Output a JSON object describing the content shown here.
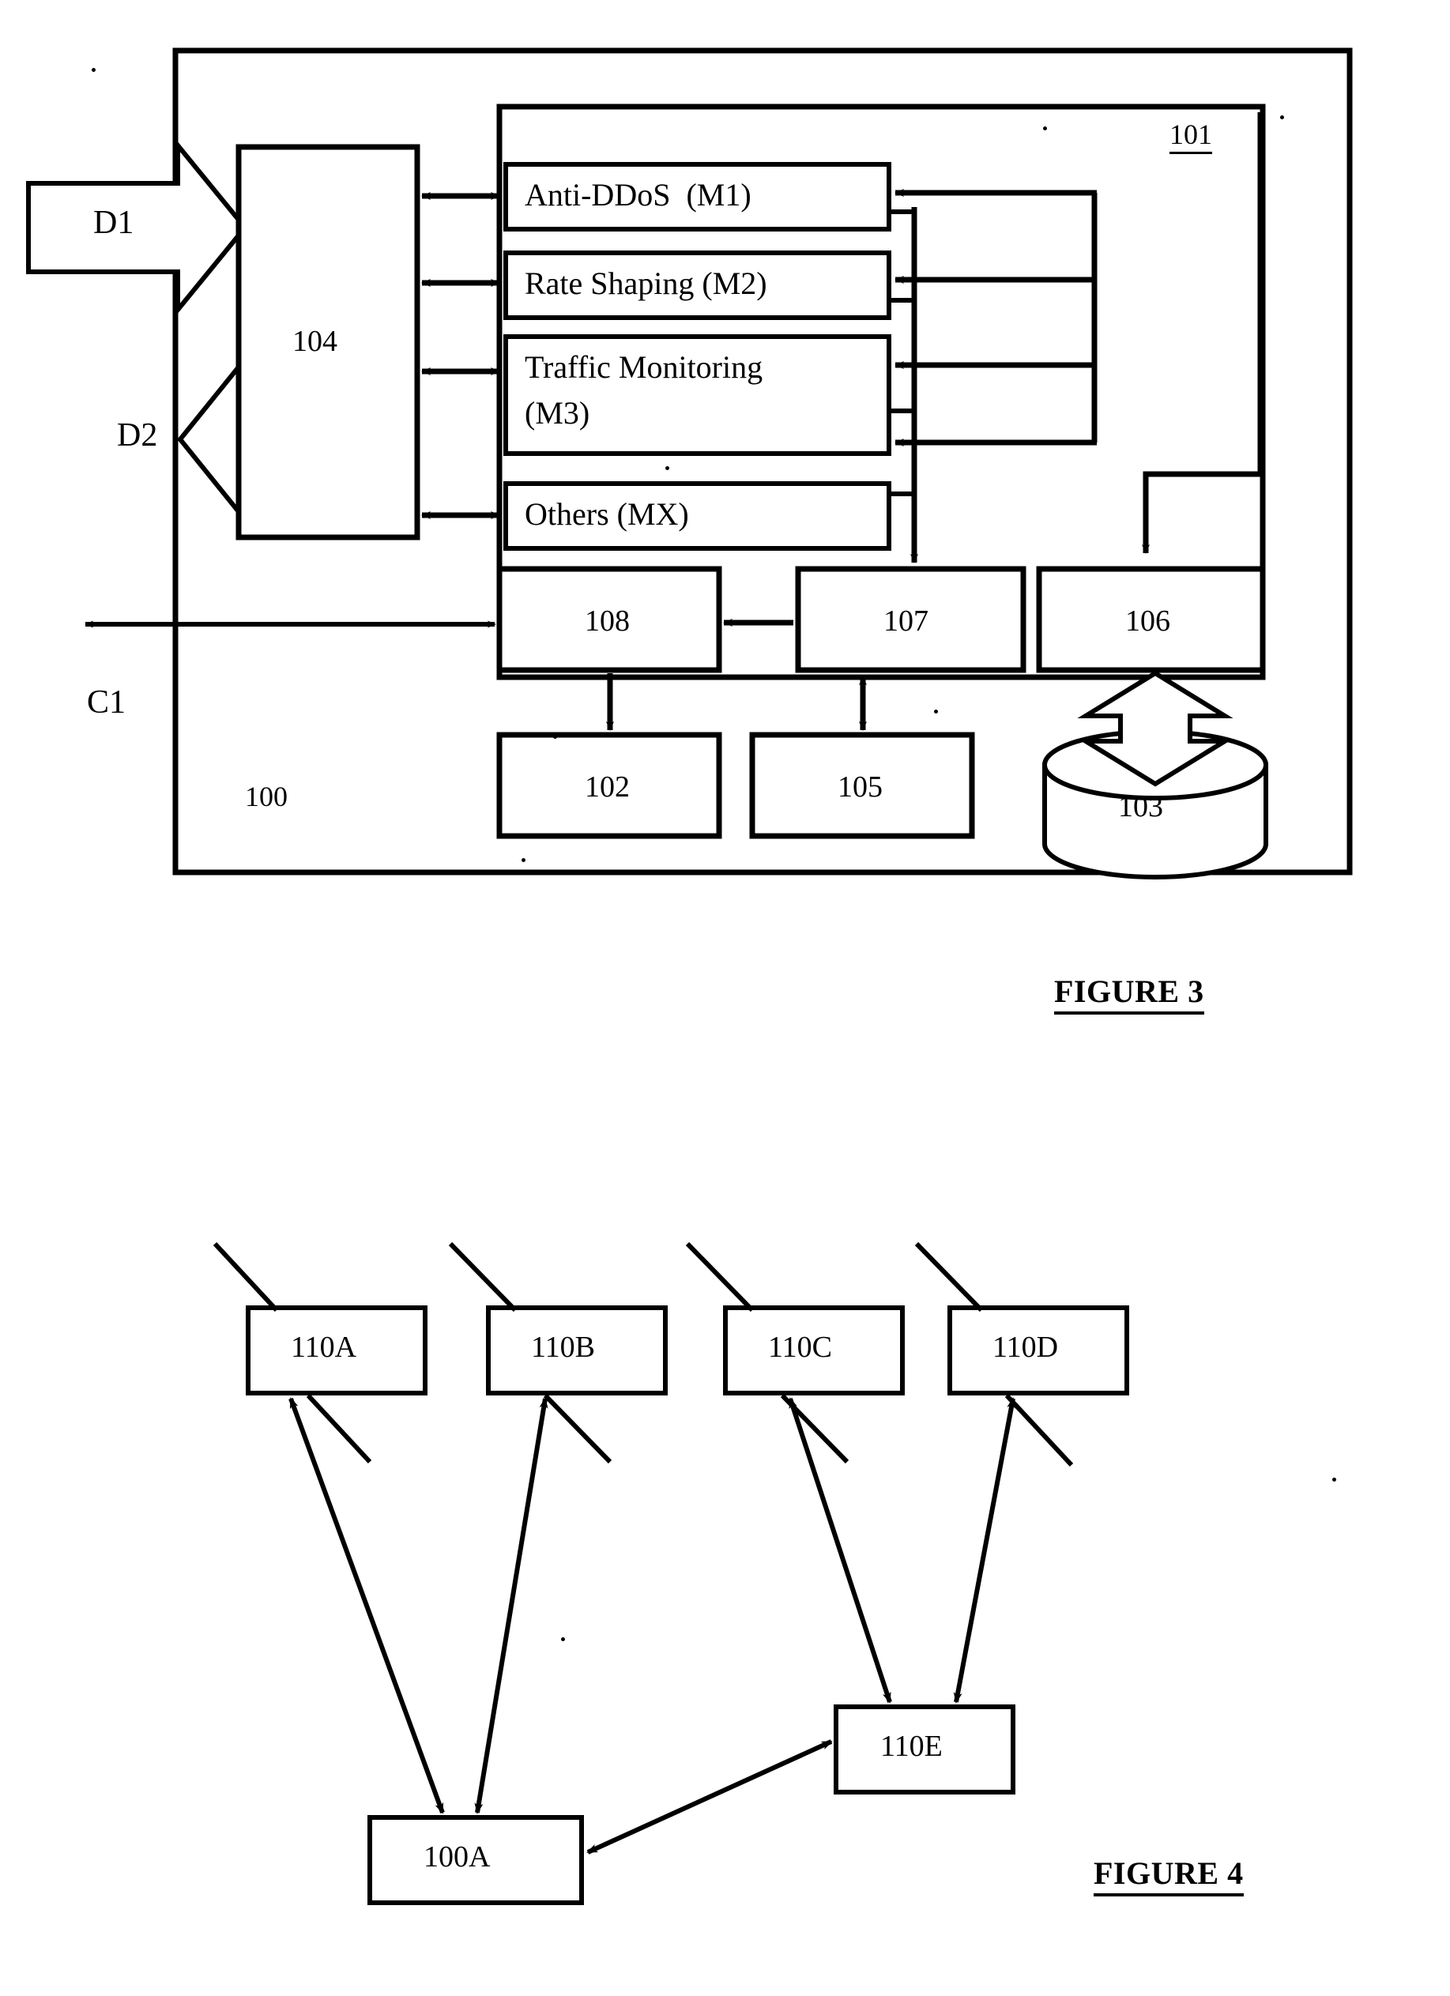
{
  "document": {
    "type": "patent-drawing-sheet",
    "figures": [
      "FIGURE 3",
      "FIGURE 4"
    ]
  },
  "figure3": {
    "caption": "FIGURE 3",
    "outer_system_ref": "100",
    "inner_container_ref": "101",
    "flow_labels": {
      "input": "D1",
      "output": "D2",
      "control": "C1"
    },
    "processor_ref": "104",
    "modules": [
      {
        "label": "Anti-DDoS  (M1)",
        "code": "M1"
      },
      {
        "label": "Rate Shaping (M2)",
        "code": "M2"
      },
      {
        "label": "Traffic Monitoring (M3)",
        "code": "M3",
        "line1": "Traffic Monitoring",
        "line2": "(M3)"
      },
      {
        "label": "Others (MX)",
        "code": "MX"
      }
    ],
    "lower_blocks": [
      {
        "ref": "108"
      },
      {
        "ref": "107"
      },
      {
        "ref": "106"
      }
    ],
    "bottom_blocks": [
      {
        "ref": "102"
      },
      {
        "ref": "105"
      }
    ],
    "storage": {
      "ref": "103",
      "shape": "cylinder"
    }
  },
  "figure4": {
    "caption": "FIGURE 4",
    "nodes": [
      {
        "ref": "110A"
      },
      {
        "ref": "110B"
      },
      {
        "ref": "110C"
      },
      {
        "ref": "110D"
      },
      {
        "ref": "110E"
      },
      {
        "ref": "100A"
      }
    ],
    "connections": [
      {
        "from": "100A",
        "to": "110A",
        "type": "double"
      },
      {
        "from": "100A",
        "to": "110B",
        "type": "double"
      },
      {
        "from": "110E",
        "to": "110C",
        "type": "double"
      },
      {
        "from": "110E",
        "to": "110D",
        "type": "double"
      },
      {
        "from": "100A",
        "to": "110E",
        "type": "double"
      }
    ]
  },
  "colors": {
    "ink": "#000000",
    "paper": "#ffffff"
  }
}
